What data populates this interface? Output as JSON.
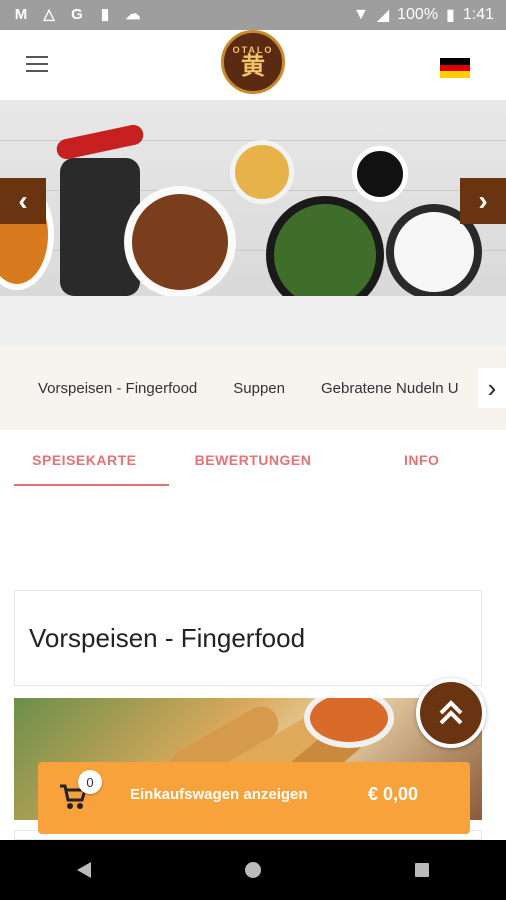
{
  "status": {
    "battery": "100%",
    "time": "1:41",
    "notification_icons": [
      "gmail-icon",
      "drive-icon",
      "google-icon",
      "sdcard-icon",
      "cloud-icon"
    ]
  },
  "header": {
    "logo_top": "OTALO",
    "logo_mark": "黄",
    "language": "de"
  },
  "categories": {
    "items": [
      "Vorspeisen - Fingerfood",
      "Suppen",
      "Gebratene Nudeln U"
    ]
  },
  "tabs": [
    "SPEISEKARTE",
    "BEWERTUNGEN",
    "INFO"
  ],
  "section": {
    "title": "Vorspeisen - Fingerfood"
  },
  "cart": {
    "count": "0",
    "label": "Einkaufswagen anzeigen",
    "total": "€ 0,00"
  },
  "colors": {
    "accent": "#6b3410",
    "tab": "#e57373",
    "cart": "#f7a23b"
  }
}
